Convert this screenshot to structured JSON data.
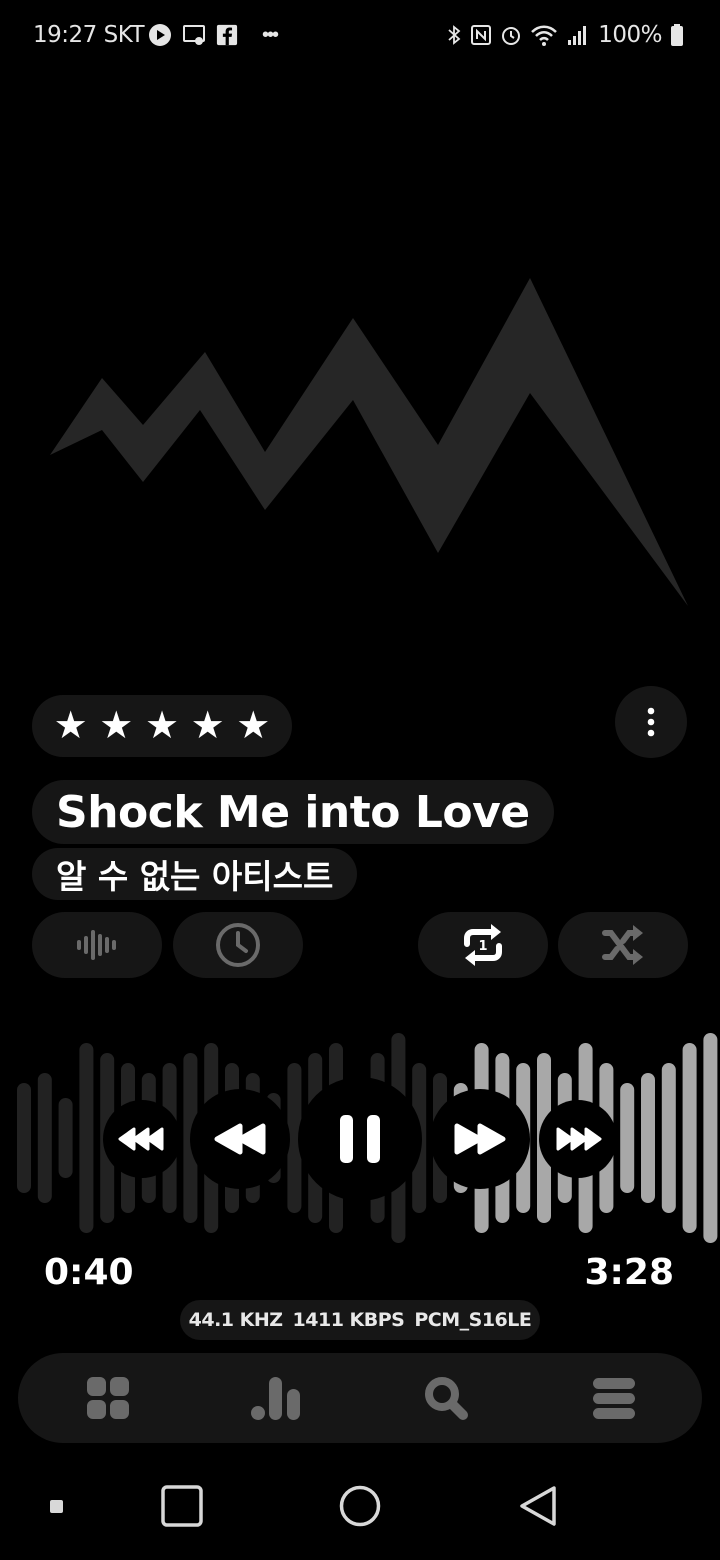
{
  "status_bar": {
    "time": "19:27",
    "carrier": "SKT",
    "battery": "100%"
  },
  "track": {
    "title": "Shock Me into Love",
    "artist": "알 수 없는 아티스트",
    "rating_stars": 5,
    "current_time": "0:40",
    "total_time": "3:28",
    "format": {
      "sample_rate": "44.1 KHZ",
      "bitrate": "1411 KBPS",
      "codec": "PCM_S16LE"
    }
  },
  "colors": {
    "background": "#000000",
    "pill": "#161616",
    "wave_played": "#222222",
    "wave_remaining": "#a8a8a8"
  },
  "controls": {
    "visualizer": "waveform-icon",
    "sleep_timer": "clock-icon",
    "repeat": "repeat-one-icon",
    "shuffle": "shuffle-icon"
  },
  "bottom_nav": [
    {
      "icon": "grid-icon"
    },
    {
      "icon": "chart-icon"
    },
    {
      "icon": "search-icon"
    },
    {
      "icon": "menu-icon"
    }
  ]
}
